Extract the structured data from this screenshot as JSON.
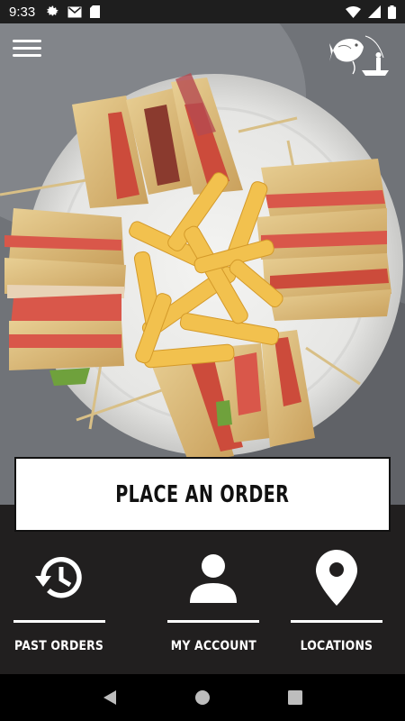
{
  "status_bar": {
    "time": "9:33",
    "left_icons": [
      "settings-icon",
      "gmail-icon",
      "sd-card-icon"
    ],
    "right_icons": [
      "wifi-icon",
      "signal-icon",
      "battery-icon"
    ]
  },
  "header": {
    "menu_icon": "hamburger-menu-icon",
    "logo_icon": "fish-and-boat-logo"
  },
  "hero": {
    "image": "club-sandwich-and-fries-photo"
  },
  "order_button": {
    "label": "PLACE AN ORDER"
  },
  "nav": {
    "items": [
      {
        "label": "PAST ORDERS",
        "icon": "history-icon"
      },
      {
        "label": "MY ACCOUNT",
        "icon": "person-icon"
      },
      {
        "label": "LOCATIONS",
        "icon": "location-pin-icon"
      }
    ]
  },
  "android_nav": {
    "buttons": [
      "back-icon",
      "home-icon",
      "recents-icon"
    ]
  },
  "colors": {
    "panel": "#211f1f",
    "button_bg": "#ffffff",
    "text_light": "#ffffff"
  }
}
